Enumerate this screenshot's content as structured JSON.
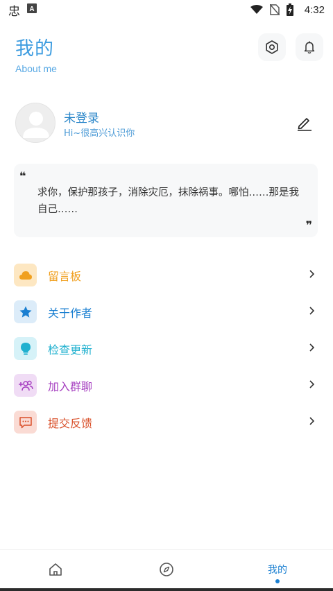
{
  "status_bar": {
    "time": "4:32",
    "icons": [
      "app-glyph-icon",
      "a-notification-icon",
      "wifi-icon",
      "no-sim-icon",
      "battery-charging-icon"
    ],
    "app_glyph": "忠"
  },
  "header": {
    "title": "我的",
    "subtitle": "About me",
    "actions": [
      "settings-icon",
      "bell-icon"
    ]
  },
  "profile": {
    "name": "未登录",
    "greeting": "Hi~很高兴认识你",
    "edit_icon": "edit-icon"
  },
  "quote": {
    "open_mark": "❝",
    "text": "求你，保护那孩子，消除灾厄，抹除祸事。哪怕……那是我自己……",
    "close_mark": "❞"
  },
  "menu": {
    "items": [
      {
        "label": "留言板",
        "icon": "cloud-icon",
        "color": "#f0a020",
        "bg": "#fde7c2"
      },
      {
        "label": "关于作者",
        "icon": "star-icon",
        "color": "#1a7fd1",
        "bg": "#dcecf9"
      },
      {
        "label": "检查更新",
        "icon": "lightbulb-icon",
        "color": "#1fb0cf",
        "bg": "#d6f2f8"
      },
      {
        "label": "加入群聊",
        "icon": "group-icon",
        "color": "#a63fc0",
        "bg": "#f0dcf5"
      },
      {
        "label": "提交反馈",
        "icon": "feedback-icon",
        "color": "#d9502a",
        "bg": "#fadbd4"
      }
    ]
  },
  "bottom_nav": {
    "items": [
      {
        "name": "home",
        "icon": "home-icon"
      },
      {
        "name": "discover",
        "icon": "compass-icon"
      },
      {
        "name": "mine",
        "label": "我的",
        "active": true
      }
    ],
    "active_color": "#1a7fd1"
  }
}
